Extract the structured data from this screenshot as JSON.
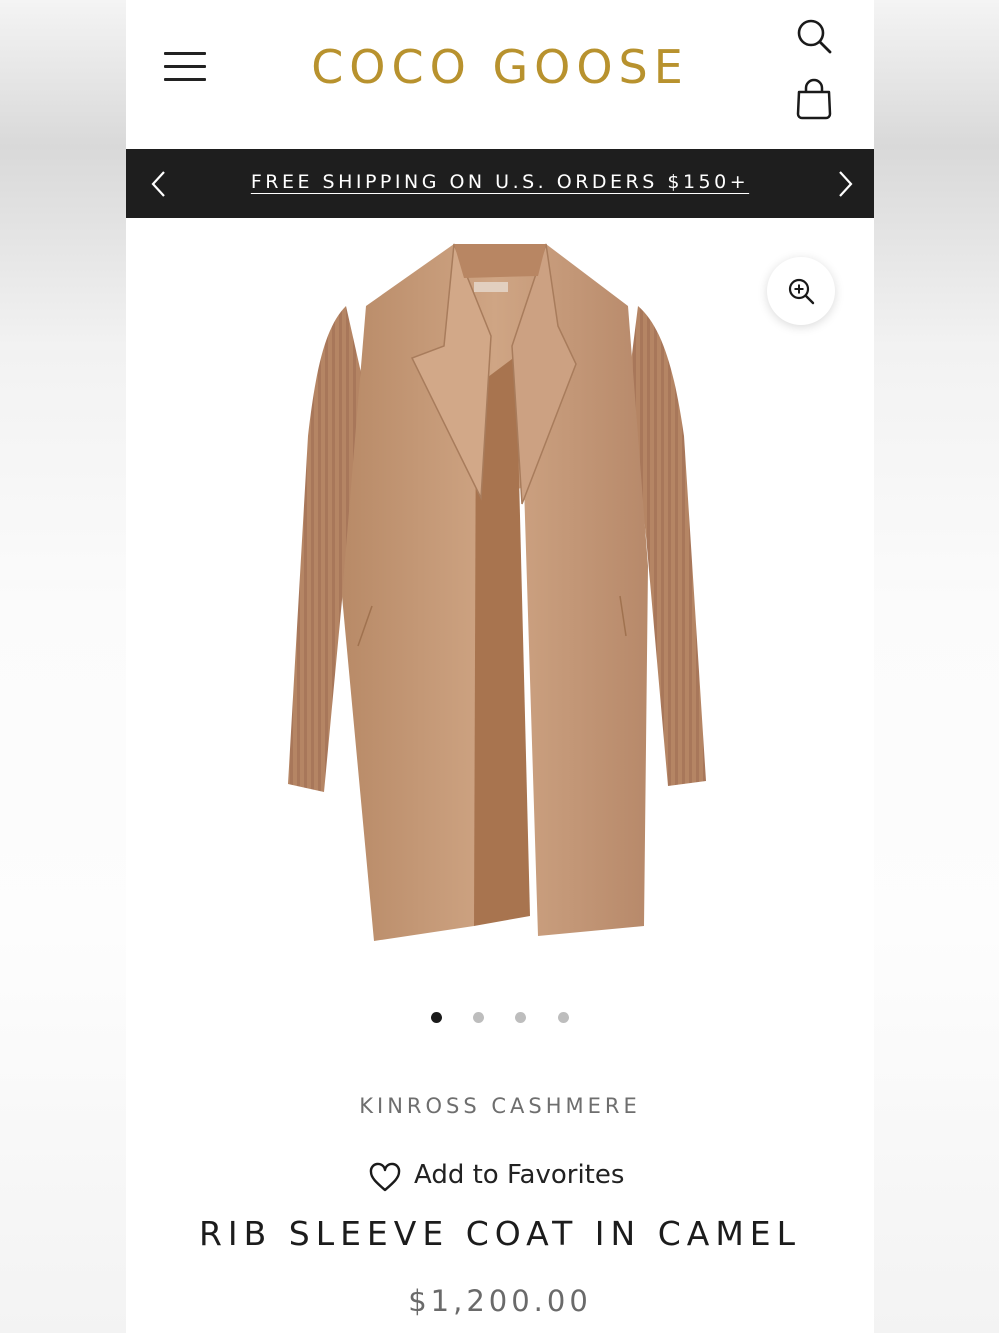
{
  "header": {
    "logo": "COCO GOOSE",
    "menu_icon": "hamburger-menu-icon",
    "search_icon": "search-icon",
    "cart_icon": "shopping-bag-icon"
  },
  "announcement": {
    "text": "FREE SHIPPING ON U.S. ORDERS $150+",
    "prev_icon": "chevron-left-icon",
    "next_icon": "chevron-right-icon"
  },
  "gallery": {
    "image_description_icon": "product-image",
    "zoom_icon": "zoom-in-icon",
    "slide_count": 4,
    "active_slide": 1
  },
  "product": {
    "vendor": "KINROSS CASHMERE",
    "favorites_label": "Add to Favorites",
    "title": "RIB SLEEVE COAT IN CAMEL",
    "price": "$1,200.00"
  },
  "colors": {
    "brand_gold": "#b8922e",
    "announcement_bg": "#1e1e1e",
    "coat_camel": "#c49877"
  }
}
